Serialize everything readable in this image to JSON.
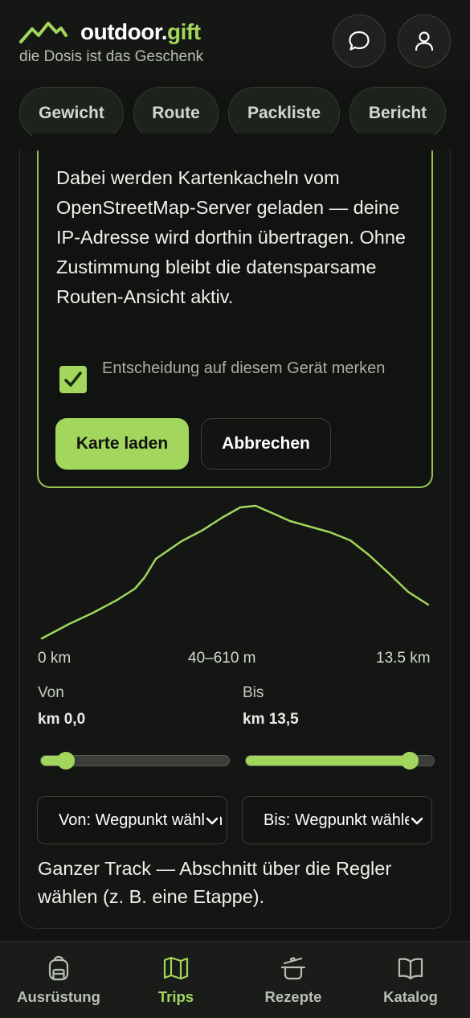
{
  "header": {
    "brand_main": "outdoor.",
    "brand_tld": "gift",
    "tagline": "die Dosis ist das Geschenk",
    "logo_icon": "mountain-logo-icon",
    "chat_icon": "chat-bubble-icon",
    "profile_icon": "user-icon"
  },
  "tabs": [
    {
      "label": "Gewicht"
    },
    {
      "label": "Route"
    },
    {
      "label": "Packliste"
    },
    {
      "label": "Bericht"
    }
  ],
  "consent": {
    "text": "Dabei werden Kartenkacheln vom OpenStreetMap-Server geladen — deine IP-Adresse wird dorthin übertragen. Ohne Zustimmung bleibt die datensparsame Routen-Ansicht aktiv.",
    "remember_label": "Entscheidung auf diesem Gerät merken",
    "remember_checked": true,
    "load_button": "Karte laden",
    "cancel_button": "Abbrechen"
  },
  "elevation": {
    "axis_start": "0 km",
    "axis_mid": "40–610 m",
    "axis_end": "13.5 km",
    "line_color": "#a3d65c"
  },
  "range": {
    "from_label": "Von",
    "from_value": "km 0,0",
    "to_label": "Bis",
    "to_value": "km 13,5",
    "from_slider_fraction": 0.0,
    "to_slider_fraction": 1.0
  },
  "selects": {
    "from_waypoint": "Von: Wegpunkt wählen",
    "to_waypoint": "Bis: Wegpunkt wählen"
  },
  "hint": "Ganzer Track — Abschnitt über die Regler wählen (z. B. eine Etappe).",
  "bottom_nav": [
    {
      "label": "Ausrüstung",
      "icon": "backpack-icon",
      "active": false
    },
    {
      "label": "Trips",
      "icon": "map-icon",
      "active": true
    },
    {
      "label": "Rezepte",
      "icon": "cooking-pot-icon",
      "active": false
    },
    {
      "label": "Katalog",
      "icon": "book-icon",
      "active": false
    }
  ],
  "colors": {
    "accent": "#a3d65c",
    "background": "#121412"
  }
}
